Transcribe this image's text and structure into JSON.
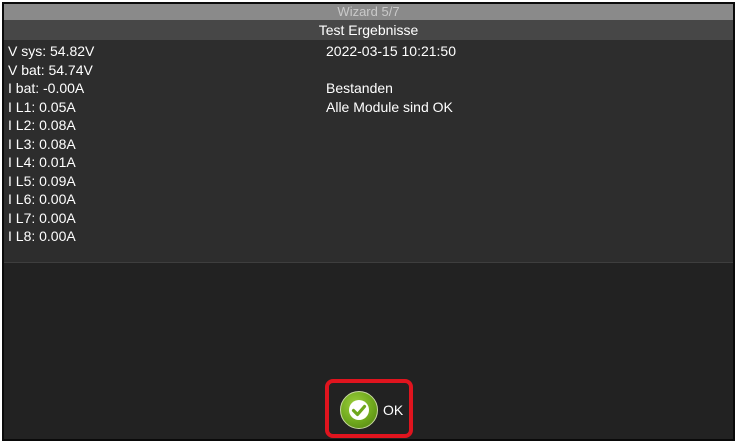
{
  "window": {
    "title": "Wizard 5/7",
    "subtitle": "Test Ergebnisse"
  },
  "measurements": [
    "V sys: 54.82V",
    "V bat: 54.74V",
    "I bat: -0.00A",
    "I L1: 0.05A",
    "I L2: 0.08A",
    "I L3: 0.08A",
    "I L4: 0.01A",
    "I L5: 0.09A",
    "I L6: 0.00A",
    "I L7: 0.00A",
    "I L8: 0.00A"
  ],
  "result": {
    "timestamp": "2022-03-15 10:21:50",
    "status": "Bestanden",
    "message": "Alle Module sind OK"
  },
  "actions": {
    "ok_label": "OK",
    "ok_icon": "checkmark-icon"
  },
  "colors": {
    "highlight": "#e0141e",
    "ok_green": "#6fa81d"
  }
}
